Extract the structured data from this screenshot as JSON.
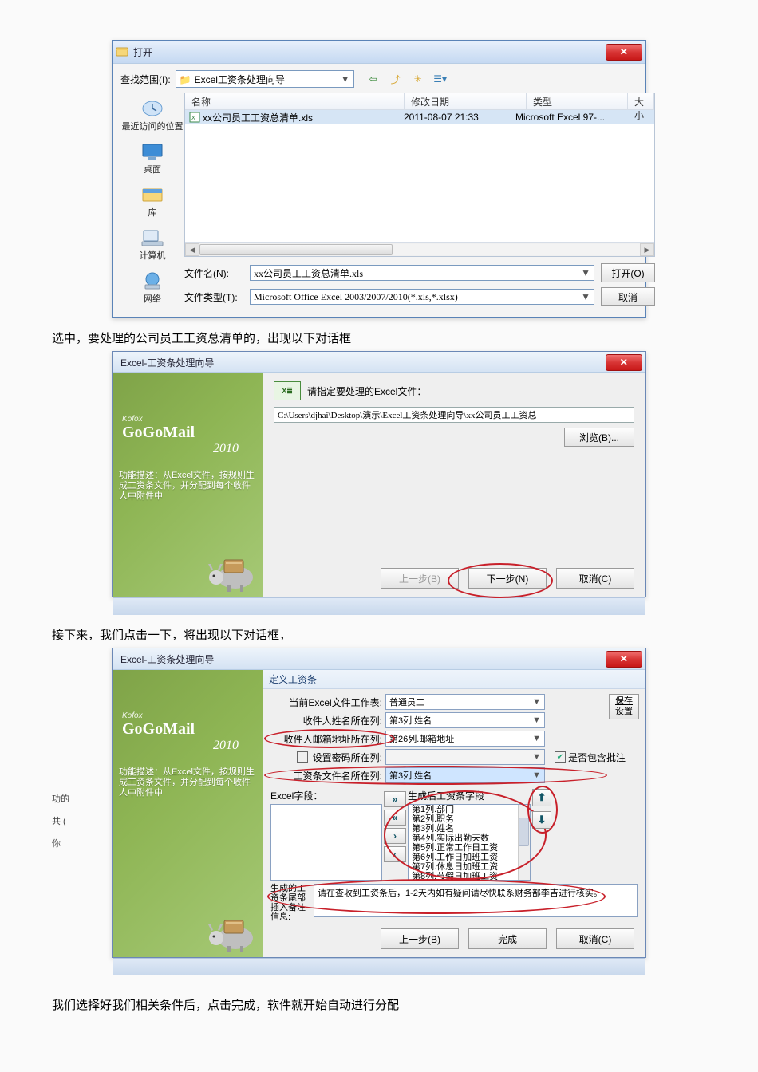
{
  "open_dialog": {
    "title": "打开",
    "look_in_label": "查找范围(I):",
    "look_in_value": "Excel工资条处理向导",
    "columns": {
      "name": "名称",
      "date": "修改日期",
      "type": "类型",
      "size": "大小"
    },
    "file": {
      "name": "xx公司员工工资总清单.xls",
      "date": "2011-08-07 21:33",
      "type": "Microsoft Excel 97-..."
    },
    "filename_label": "文件名(N):",
    "filename_value": "xx公司员工工资总清单.xls",
    "filetype_label": "文件类型(T):",
    "filetype_value": "Microsoft Office Excel 2003/2007/2010(*.xls,*.xlsx)",
    "open_btn": "打开(O)",
    "cancel_btn": "取消",
    "sidebar": {
      "recent": "最近访问的位置",
      "desktop": "桌面",
      "library": "库",
      "computer": "计算机",
      "network": "网络"
    }
  },
  "caption1": "选中，要处理的公司员工工资总清单的，出现以下对话框",
  "wizard": {
    "title": "Excel-工资条处理向导",
    "brand_small": "Kofox",
    "brand": "GoGoMail",
    "brand_year": "2010",
    "left_desc": "功能描述：从Excel文件，按规则生成工资条文件，并分配到每个收件人中附件中",
    "prompt": "请指定要处理的Excel文件：",
    "path": "C:\\Users\\djhai\\Desktop\\演示\\Excel工资条处理向导\\xx公司员工工资总",
    "browse_btn": "浏览(B)...",
    "prev_btn": "上一步(B)",
    "next_btn": "下一步(N)",
    "cancel_btn": "取消(C)"
  },
  "caption2": "接下来，我们点击一下，将出现以下对话框，",
  "wizard3": {
    "title": "Excel-工资条处理向导",
    "group": "定义工资条",
    "row_sheet_label": "当前Excel文件工作表:",
    "row_sheet_value": "普通员工",
    "row_name_label": "收件人姓名所在列:",
    "row_name_value": "第3列.姓名",
    "row_mail_label": "收件人邮箱地址所在列:",
    "row_mail_value": "第26列.邮箱地址",
    "row_pwd_label": "设置密码所在列:",
    "row_remark_chk": "是否包含批注",
    "row_fname_label": "工资条文件名所在列:",
    "row_fname_value": "第3列.姓名",
    "save_settings": "保存\n设置",
    "left_list_label": "Excel字段：",
    "right_list_label": "生成后工资条字段",
    "right_items": [
      "第1列.部门",
      "第2列.职务",
      "第3列.姓名",
      "第4列.实际出勤天数",
      "第5列.正常工作日工资",
      "第6列.工作日加班工资",
      "第7列.休息日加班工资",
      "第8列.节假日加班工资"
    ],
    "note_label": "生成的工资条尾部插入备注信息:",
    "note_text": "请在查收到工资条后，1-2天内如有疑问请尽快联系财务部李吉进行核实。",
    "prev_btn": "上一步(B)",
    "finish_btn": "完成",
    "cancel_btn": "取消(C)"
  },
  "caption3": "我们选择好我们相关条件后，点击完成，软件就开始自动进行分配",
  "side": {
    "a": "功的",
    "b": "共 (",
    "c": "你"
  }
}
